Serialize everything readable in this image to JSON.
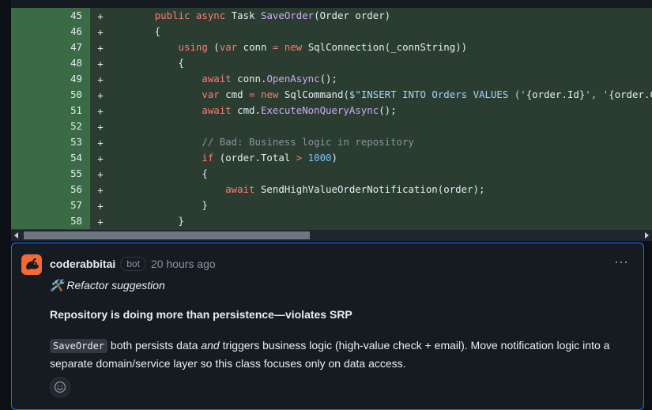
{
  "diff": {
    "rows": [
      {
        "num": "45",
        "mark": "+",
        "segs": [
          {
            "t": "        "
          },
          {
            "t": "public",
            "c": "kw"
          },
          {
            "t": " "
          },
          {
            "t": "async",
            "c": "kw"
          },
          {
            "t": " Task "
          },
          {
            "t": "SaveOrder",
            "c": "fn"
          },
          {
            "t": "(Order order)"
          }
        ]
      },
      {
        "num": "46",
        "mark": "+",
        "segs": [
          {
            "t": "        {"
          }
        ]
      },
      {
        "num": "47",
        "mark": "+",
        "segs": [
          {
            "t": "            "
          },
          {
            "t": "using",
            "c": "kw"
          },
          {
            "t": " ("
          },
          {
            "t": "var",
            "c": "kw"
          },
          {
            "t": " conn "
          },
          {
            "t": "=",
            "c": "kw"
          },
          {
            "t": " "
          },
          {
            "t": "new",
            "c": "kw"
          },
          {
            "t": " SqlConnection(_connString))"
          }
        ]
      },
      {
        "num": "48",
        "mark": "+",
        "segs": [
          {
            "t": "            {"
          }
        ]
      },
      {
        "num": "49",
        "mark": "+",
        "segs": [
          {
            "t": "                "
          },
          {
            "t": "await",
            "c": "kw"
          },
          {
            "t": " conn."
          },
          {
            "t": "OpenAsync",
            "c": "fn"
          },
          {
            "t": "();"
          }
        ]
      },
      {
        "num": "50",
        "mark": "+",
        "segs": [
          {
            "t": "                "
          },
          {
            "t": "var",
            "c": "kw"
          },
          {
            "t": " cmd "
          },
          {
            "t": "=",
            "c": "kw"
          },
          {
            "t": " "
          },
          {
            "t": "new",
            "c": "kw"
          },
          {
            "t": " SqlCommand("
          },
          {
            "t": "$\"INSERT INTO Orders VALUES ('",
            "c": "str"
          },
          {
            "t": "{order.Id}"
          },
          {
            "t": "', '",
            "c": "str"
          },
          {
            "t": "{order.Cu"
          }
        ]
      },
      {
        "num": "51",
        "mark": "+",
        "segs": [
          {
            "t": "                "
          },
          {
            "t": "await",
            "c": "kw"
          },
          {
            "t": " cmd."
          },
          {
            "t": "ExecuteNonQueryAsync",
            "c": "fn"
          },
          {
            "t": "();"
          }
        ]
      },
      {
        "num": "52",
        "mark": "+",
        "segs": [
          {
            "t": ""
          }
        ]
      },
      {
        "num": "53",
        "mark": "+",
        "segs": [
          {
            "t": "                "
          },
          {
            "t": "// Bad: Business logic in repository",
            "c": "cm"
          }
        ]
      },
      {
        "num": "54",
        "mark": "+",
        "segs": [
          {
            "t": "                "
          },
          {
            "t": "if",
            "c": "kw"
          },
          {
            "t": " (order.Total "
          },
          {
            "t": ">",
            "c": "kw"
          },
          {
            "t": " "
          },
          {
            "t": "1000",
            "c": "num"
          },
          {
            "t": ")"
          }
        ]
      },
      {
        "num": "55",
        "mark": "+",
        "segs": [
          {
            "t": "                {"
          }
        ]
      },
      {
        "num": "56",
        "mark": "+",
        "segs": [
          {
            "t": "                    "
          },
          {
            "t": "await",
            "c": "kw"
          },
          {
            "t": " SendHighValueOrderNotification(order);"
          }
        ]
      },
      {
        "num": "57",
        "mark": "+",
        "segs": [
          {
            "t": "                }"
          }
        ]
      },
      {
        "num": "58",
        "mark": "+",
        "segs": [
          {
            "t": "            }"
          }
        ]
      }
    ]
  },
  "comment": {
    "author": "coderabbitai",
    "badge": "bot",
    "time": "20 hours ago",
    "more_icon": "⋯",
    "tag_icon": "🛠️",
    "tag": "Refactor suggestion",
    "heading": "Repository is doing more than persistence—violates SRP",
    "body_code": "SaveOrder",
    "body_pre": " both persists data ",
    "body_em": "and",
    "body_post": " triggers business logic (high-value check + email). Move notification logic into a separate domain/service layer so this class focuses only on data access."
  },
  "colors": {
    "accent": "#1f6feb",
    "added_bg": "#2a3d30",
    "added_gutter": "#3a6b44",
    "avatar": "#f46a35"
  }
}
